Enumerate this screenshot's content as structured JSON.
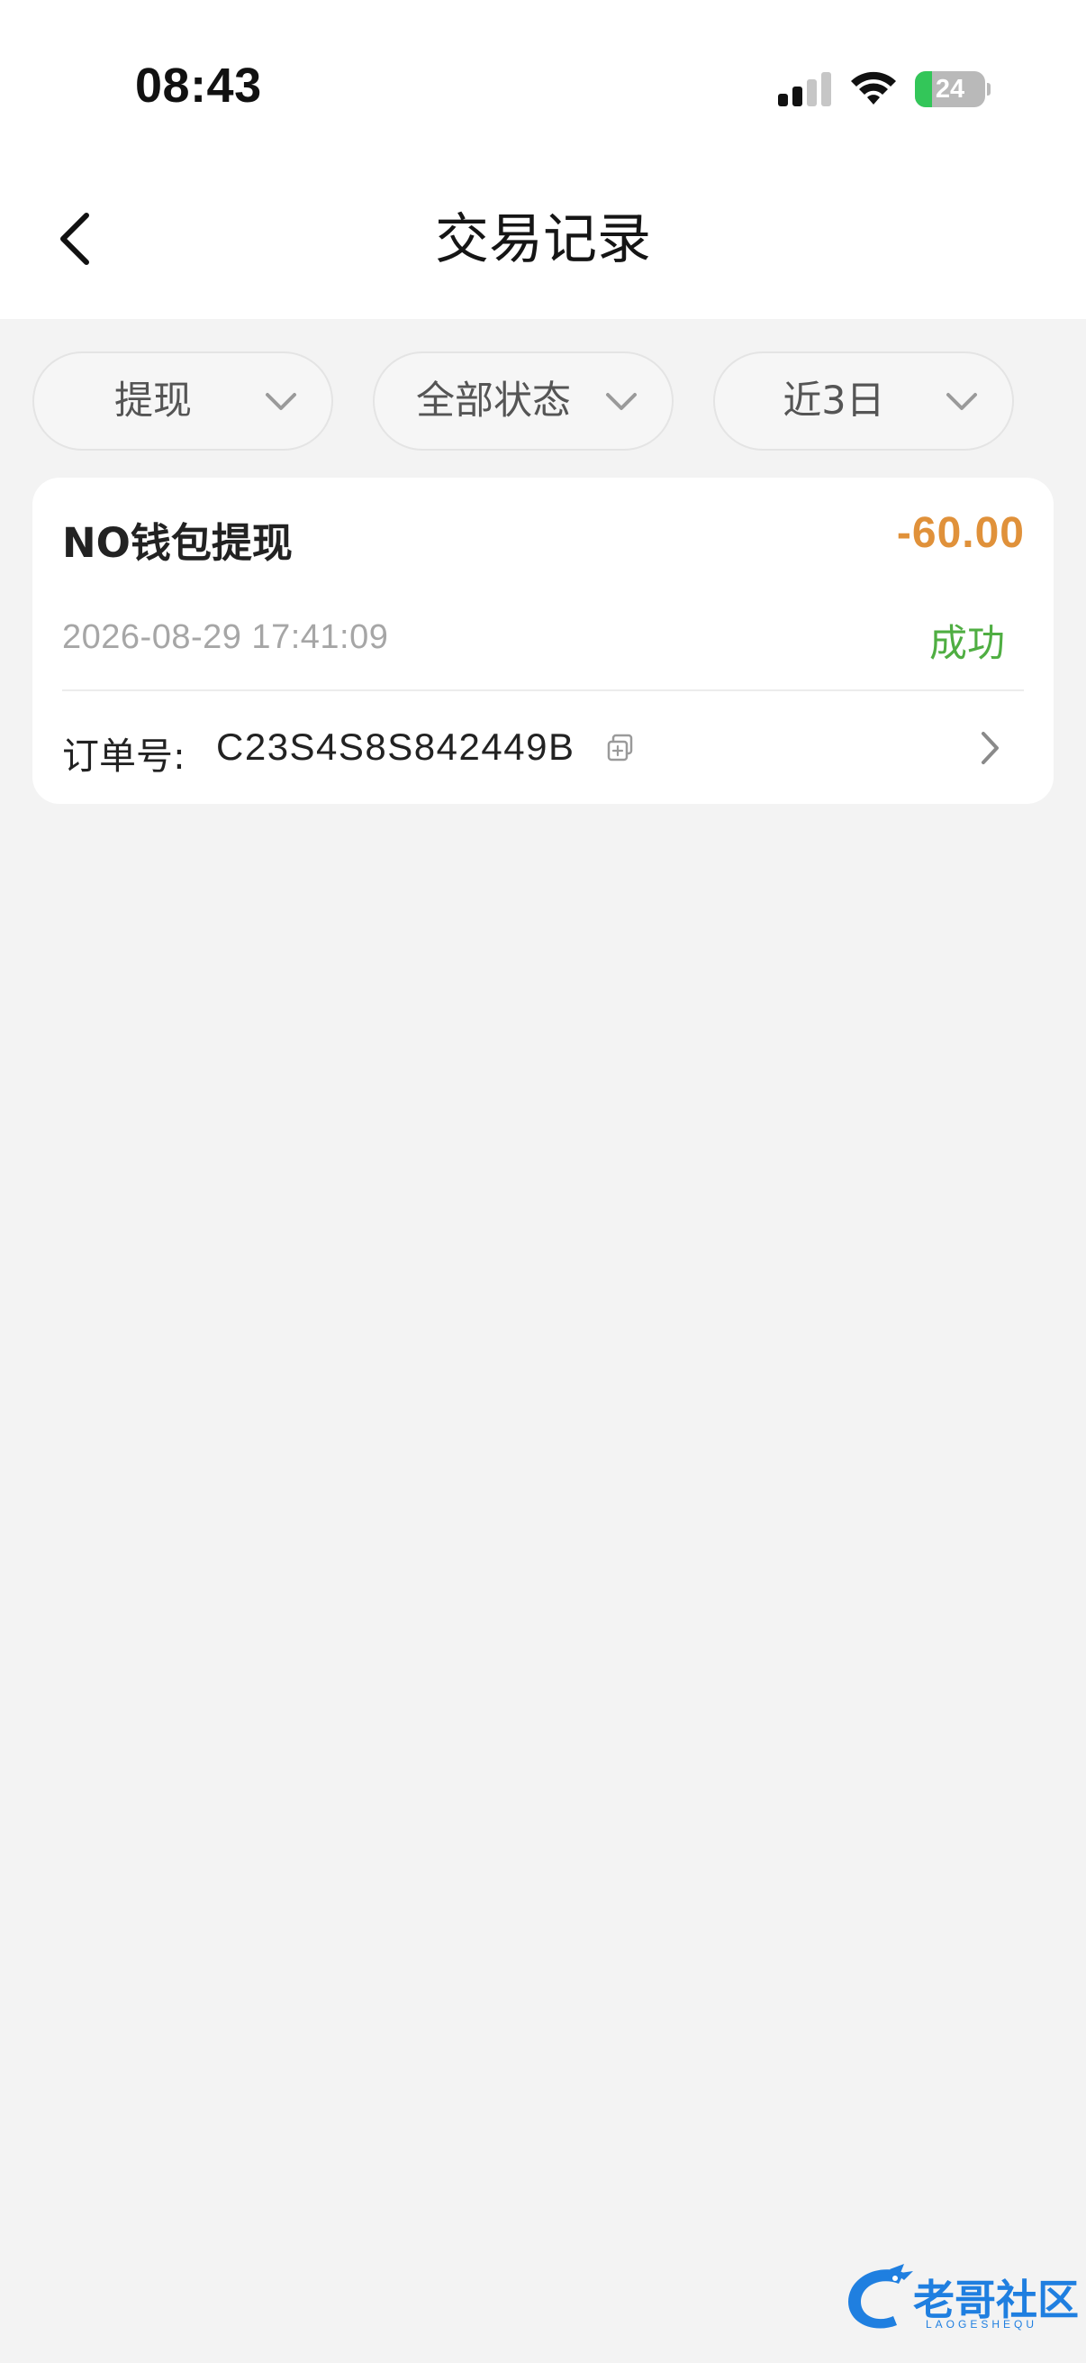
{
  "status_bar": {
    "time": "08:43",
    "signal_bars_active": 2,
    "signal_bars_total": 4,
    "battery_level": "24",
    "battery_fraction": 0.24,
    "icons": [
      "signal-icon",
      "wifi-icon",
      "battery-charging-icon"
    ]
  },
  "header": {
    "back_icon": "back-arrow-icon",
    "title": "交易记录"
  },
  "filters": [
    {
      "label": "提现",
      "icon": "chevron-down-icon"
    },
    {
      "label": "全部状态",
      "icon": "chevron-down-icon"
    },
    {
      "label": "近3日",
      "icon": "chevron-down-icon"
    }
  ],
  "transactions": [
    {
      "title": "NO钱包提现",
      "amount": "-60.00",
      "datetime": "2026-08-29 17:41:09",
      "status": "成功",
      "order_label": "订单号:",
      "order_number": "C23S4S8S842449B",
      "copy_icon": "copy-icon",
      "detail_icon": "chevron-right-icon"
    }
  ],
  "colors": {
    "background": "#f3f3f3",
    "card": "#ffffff",
    "amount": "#e0913a",
    "status_success": "#4fae42",
    "battery_charging": "#33c659",
    "watermark": "#1f7fe0"
  },
  "watermark": {
    "text": "老哥社区",
    "subtext": "LAOGESHEQU"
  }
}
